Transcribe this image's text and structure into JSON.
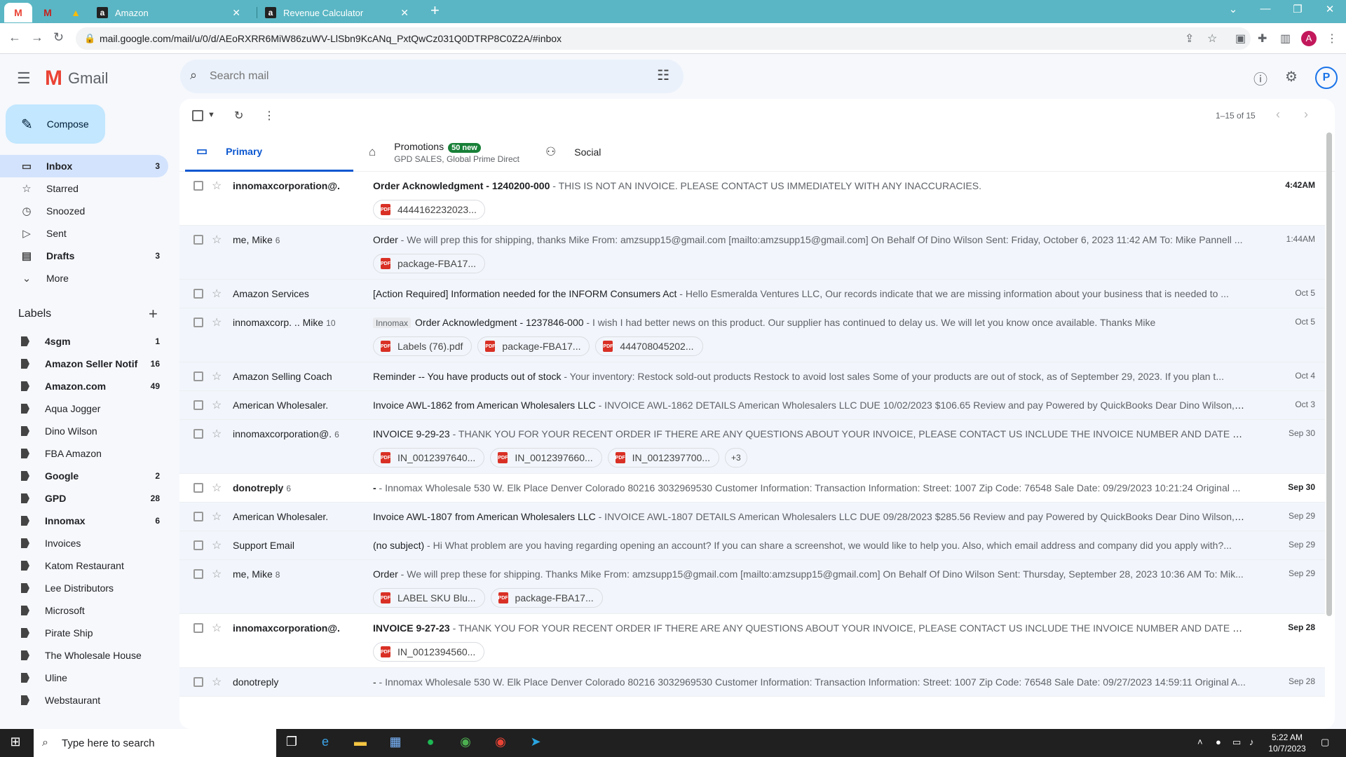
{
  "browser": {
    "tabs": [
      {
        "label": "Amazon",
        "favicon": "a"
      },
      {
        "label": "Revenue Calculator",
        "favicon": "a"
      }
    ],
    "url": "mail.google.com/mail/u/0/d/AEoRXRR6MiW86zuWV-LlSbn9KcANq_PxtQwCz031Q0DTRP8C0Z2A/#inbox",
    "avatar_letter": "A"
  },
  "gmail": {
    "brand": "Gmail",
    "search_placeholder": "Search mail",
    "profile_letter": "P"
  },
  "sidebar": {
    "compose": "Compose",
    "nav": [
      {
        "label": "Inbox",
        "count": "3",
        "icon": "inbox-icon"
      },
      {
        "label": "Starred",
        "count": "",
        "icon": "star-icon"
      },
      {
        "label": "Snoozed",
        "count": "",
        "icon": "clock-icon"
      },
      {
        "label": "Sent",
        "count": "",
        "icon": "send-icon"
      },
      {
        "label": "Drafts",
        "count": "3",
        "icon": "draft-icon"
      },
      {
        "label": "More",
        "count": "",
        "icon": "chevron-down-icon"
      }
    ],
    "labels_title": "Labels",
    "labels": [
      {
        "label": "4sgm",
        "count": "1"
      },
      {
        "label": "Amazon Seller Notif",
        "count": "16"
      },
      {
        "label": "Amazon.com",
        "count": "49"
      },
      {
        "label": "Aqua Jogger",
        "count": ""
      },
      {
        "label": "Dino Wilson",
        "count": ""
      },
      {
        "label": "FBA Amazon",
        "count": ""
      },
      {
        "label": "Google",
        "count": "2"
      },
      {
        "label": "GPD",
        "count": "28"
      },
      {
        "label": "Innomax",
        "count": "6"
      },
      {
        "label": "Invoices",
        "count": ""
      },
      {
        "label": "Katom Restaurant",
        "count": ""
      },
      {
        "label": "Lee Distributors",
        "count": ""
      },
      {
        "label": "Microsoft",
        "count": ""
      },
      {
        "label": "Pirate Ship",
        "count": ""
      },
      {
        "label": "The Wholesale House",
        "count": ""
      },
      {
        "label": "Uline",
        "count": ""
      },
      {
        "label": "Webstaurant",
        "count": ""
      }
    ]
  },
  "toolbar": {
    "pagination": "1–15 of 15"
  },
  "category_tabs": {
    "primary": "Primary",
    "promotions": "Promotions",
    "promotions_badge": "50 new",
    "promotions_sub": "GPD SALES, Global Prime Direct",
    "social": "Social"
  },
  "emails": [
    {
      "from": "innomaxcorporation@.",
      "n": "",
      "label": "",
      "subject": "Order Acknowledgment - 1240200-000",
      "snippet": " - THIS IS NOT AN INVOICE. PLEASE CONTACT US IMMEDIATELY WITH ANY INACCURACIES.",
      "date": "4:42AM",
      "unread": true,
      "attachments": [
        "4444162232023..."
      ]
    },
    {
      "from": "me, Mike",
      "n": "6",
      "label": "",
      "subject": "Order",
      "snippet": " - We will prep this for shipping, thanks Mike From: amzsupp15@gmail.com [mailto:amzsupp15@gmail.com] On Behalf Of Dino Wilson Sent: Friday, October 6, 2023 11:42 AM To: Mike Pannell ...",
      "date": "1:44AM",
      "unread": false,
      "attachments": [
        "package-FBA17..."
      ]
    },
    {
      "from": "Amazon Services",
      "n": "",
      "label": "",
      "subject": "[Action Required] Information needed for the INFORM Consumers Act",
      "snippet": " - Hello Esmeralda Ventures LLC, Our records indicate that we are missing information about your business that is needed to ...",
      "date": "Oct 5",
      "unread": false,
      "attachments": []
    },
    {
      "from": "innomaxcorp. .. Mike",
      "n": "10",
      "label": "Innomax",
      "subject": "Order Acknowledgment - 1237846-000",
      "snippet": " - I wish I had better news on this product. Our supplier has continued to delay us. We will let you know once available. Thanks Mike",
      "date": "Oct 5",
      "unread": false,
      "attachments": [
        "Labels (76).pdf",
        "package-FBA17...",
        "444708045202..."
      ]
    },
    {
      "from": "Amazon Selling Coach",
      "n": "",
      "label": "",
      "subject": "Reminder -- You have products out of stock",
      "snippet": " - Your inventory: Restock sold-out products Restock to avoid lost sales Some of your products are out of stock, as of September 29, 2023. If you plan t...",
      "date": "Oct 4",
      "unread": false,
      "attachments": []
    },
    {
      "from": "American Wholesaler.",
      "n": "",
      "label": "",
      "subject": "Invoice AWL-1862 from American Wholesalers LLC",
      "snippet": " - INVOICE AWL-1862 DETAILS American Wholesalers LLC DUE 10/02/2023 $106.65 Review and pay Powered by QuickBooks Dear Dino Wilson, W...",
      "date": "Oct 3",
      "unread": false,
      "attachments": []
    },
    {
      "from": "innomaxcorporation@.",
      "n": "6",
      "label": "",
      "subject": "INVOICE 9-29-23",
      "snippet": " - THANK YOU FOR YOUR RECENT ORDER IF THERE ARE ANY QUESTIONS ABOUT YOUR INVOICE, PLEASE CONTACT US INCLUDE THE INVOICE NUMBER AND DATE OF INVOICE",
      "date": "Sep 30",
      "unread": false,
      "attachments": [
        "IN_0012397640...",
        "IN_0012397660...",
        "IN_0012397700..."
      ],
      "more": "+3"
    },
    {
      "from": "donotreply",
      "n": "6",
      "label": "",
      "subject": "-",
      "snippet": " - Innomax Wholesale 530 W. Elk Place Denver Colorado 80216 3032969530 Customer Information: Transaction Information: Street: 1007 Zip Code: 76548 Sale Date: 09/29/2023 10:21:24 Original ...",
      "date": "Sep 30",
      "unread": true,
      "attachments": []
    },
    {
      "from": "American Wholesaler.",
      "n": "",
      "label": "",
      "subject": "Invoice AWL-1807 from American Wholesalers LLC",
      "snippet": " - INVOICE AWL-1807 DETAILS American Wholesalers LLC DUE 09/28/2023 $285.56 Review and pay Powered by QuickBooks Dear Dino Wilson, W...",
      "date": "Sep 29",
      "unread": false,
      "attachments": []
    },
    {
      "from": "Support Email",
      "n": "",
      "label": "",
      "subject": "(no subject)",
      "snippet": " - Hi What problem are you having regarding opening an account? If you can share a screenshot, we would like to help you. Also, which email address and company did you apply with?...",
      "date": "Sep 29",
      "unread": false,
      "attachments": []
    },
    {
      "from": "me, Mike",
      "n": "8",
      "label": "",
      "subject": "Order",
      "snippet": " - We will prep these for shipping. Thanks Mike From: amzsupp15@gmail.com [mailto:amzsupp15@gmail.com] On Behalf Of Dino Wilson Sent: Thursday, September 28, 2023 10:36 AM To: Mik...",
      "date": "Sep 29",
      "unread": false,
      "attachments": [
        "LABEL SKU Blu...",
        "package-FBA17..."
      ]
    },
    {
      "from": "innomaxcorporation@.",
      "n": "",
      "label": "",
      "subject": "INVOICE 9-27-23",
      "snippet": " - THANK YOU FOR YOUR RECENT ORDER IF THERE ARE ANY QUESTIONS ABOUT YOUR INVOICE, PLEASE CONTACT US INCLUDE THE INVOICE NUMBER AND DATE OF INVOICE",
      "date": "Sep 28",
      "unread": true,
      "attachments": [
        "IN_0012394560..."
      ]
    },
    {
      "from": "donotreply",
      "n": "",
      "label": "",
      "subject": "-",
      "snippet": " - Innomax Wholesale 530 W. Elk Place Denver Colorado 80216 3032969530 Customer Information: Transaction Information: Street: 1007 Zip Code: 76548 Sale Date: 09/27/2023 14:59:11 Original A...",
      "date": "Sep 28",
      "unread": false,
      "attachments": []
    }
  ],
  "taskbar": {
    "search_placeholder": "Type here to search",
    "time": "5:22 AM",
    "date": "10/7/2023"
  }
}
